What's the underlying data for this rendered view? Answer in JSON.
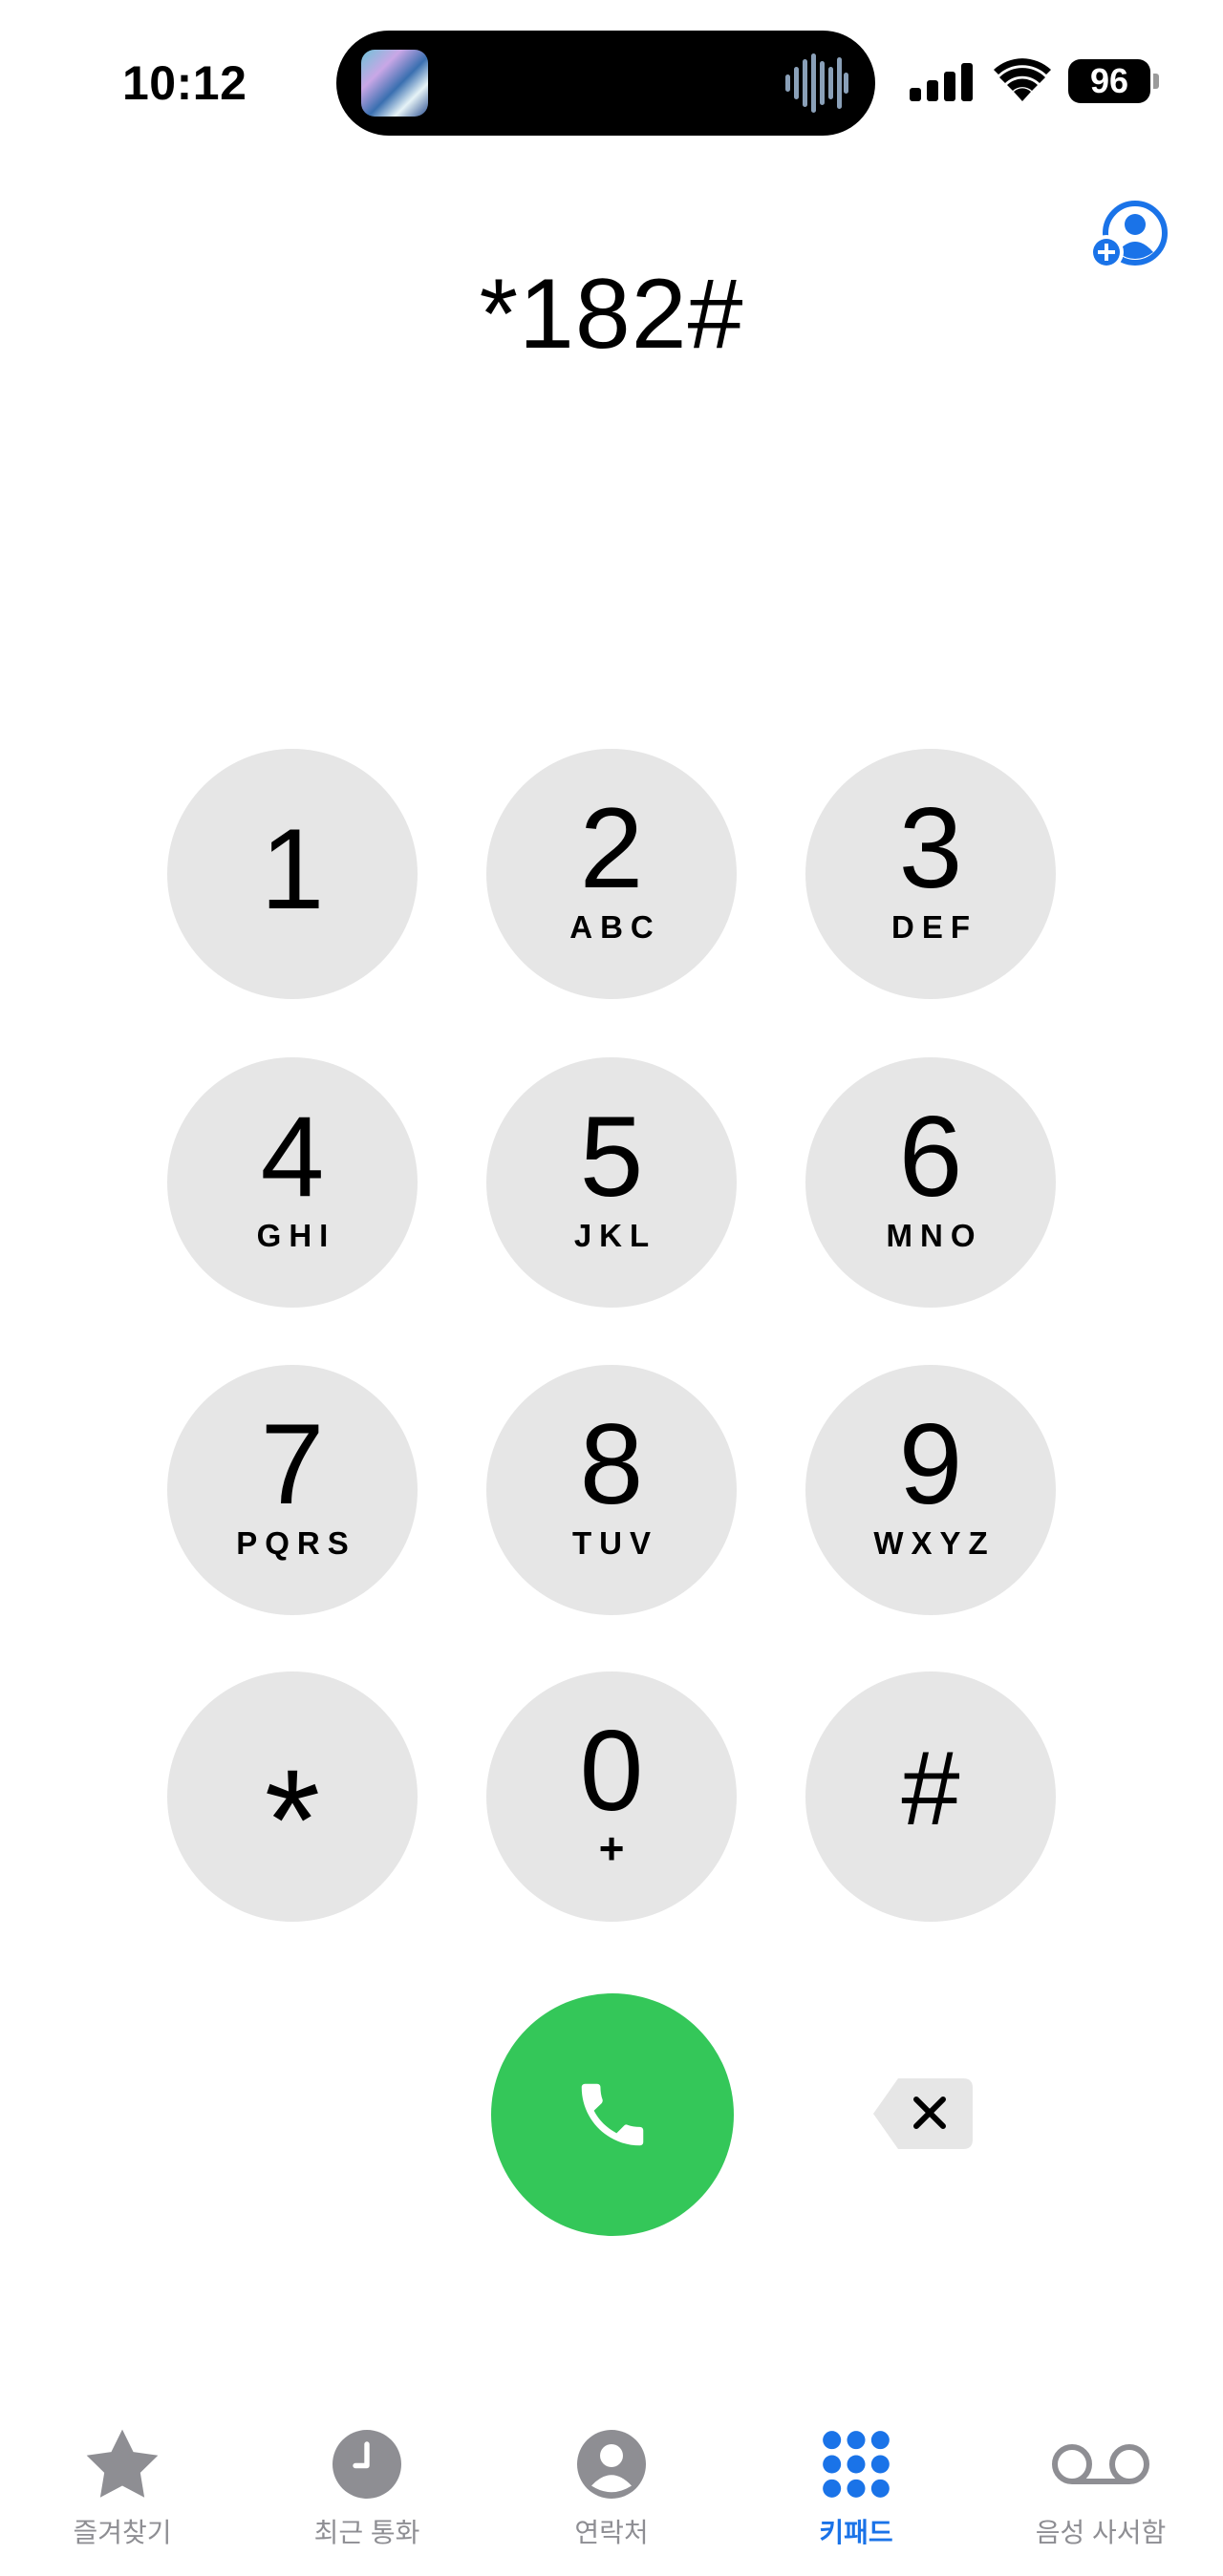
{
  "status_bar": {
    "time": "10:12",
    "battery_level": "96",
    "signal_icon": "cellular-signal-icon",
    "wifi_icon": "wifi-icon"
  },
  "dynamic_island": {
    "artwork_icon": "now-playing-artwork-icon",
    "audio_icon": "audio-waveform-icon"
  },
  "header": {
    "add_contact_icon": "add-contact-icon"
  },
  "dialed_number": "*182#",
  "keypad": {
    "keys": [
      {
        "digit": "1",
        "letters": ""
      },
      {
        "digit": "2",
        "letters": "ABC"
      },
      {
        "digit": "3",
        "letters": "DEF"
      },
      {
        "digit": "4",
        "letters": "GHI"
      },
      {
        "digit": "5",
        "letters": "JKL"
      },
      {
        "digit": "6",
        "letters": "MNO"
      },
      {
        "digit": "7",
        "letters": "PQRS"
      },
      {
        "digit": "8",
        "letters": "TUV"
      },
      {
        "digit": "9",
        "letters": "WXYZ"
      },
      {
        "digit": "*",
        "letters": ""
      },
      {
        "digit": "0",
        "letters": "+"
      },
      {
        "digit": "#",
        "letters": ""
      }
    ]
  },
  "actions": {
    "call_icon": "phone-icon",
    "delete_icon": "backspace-icon"
  },
  "tabs": [
    {
      "label": "즐겨찾기",
      "icon": "star-icon",
      "active": false
    },
    {
      "label": "최근 통화",
      "icon": "clock-icon",
      "active": false
    },
    {
      "label": "연락처",
      "icon": "person-icon",
      "active": false
    },
    {
      "label": "키패드",
      "icon": "keypad-icon",
      "active": true
    },
    {
      "label": "음성 사서함",
      "icon": "voicemail-icon",
      "active": false
    }
  ],
  "colors": {
    "accent": "#1a73e8",
    "call_green": "#34c759",
    "key_background": "#e6e6e6",
    "tab_inactive": "#8e8e93"
  }
}
